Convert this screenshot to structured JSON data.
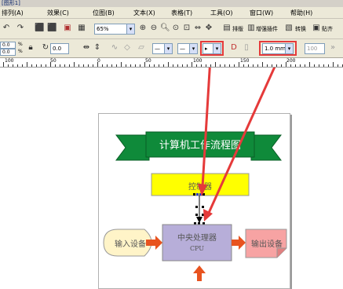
{
  "window": {
    "title": "[图形1]"
  },
  "menu": [
    {
      "label": "排列(A)",
      "key": "arrange"
    },
    {
      "label": "效果(C)",
      "key": "effects"
    },
    {
      "label": "位图(B)",
      "key": "bitmaps"
    },
    {
      "label": "文本(X)",
      "key": "text"
    },
    {
      "label": "表格(T)",
      "key": "table"
    },
    {
      "label": "工具(O)",
      "key": "tools"
    },
    {
      "label": "窗口(W)",
      "key": "window"
    },
    {
      "label": "帮助(H)",
      "key": "help"
    }
  ],
  "toolbar": {
    "zoom_value": "65%",
    "layout_label": "排版",
    "plugins_label": "增强插件",
    "convert_label": "转换",
    "paste_label": "贴齐"
  },
  "propertybar": {
    "x_value": "0.0",
    "y_value": "0.0",
    "x_unit": "%",
    "y_unit": "%",
    "rotation_value": "0.0",
    "outline_width_value": "1.0 mm",
    "opacity_value": "100"
  },
  "ruler": {
    "ticks": [
      "100",
      "50",
      "0",
      "50",
      "100",
      "150",
      "200"
    ]
  },
  "diagram": {
    "banner_text": "计算机工作流程图",
    "controller_text": "控制器",
    "input_text": "输入设备",
    "cpu_text_line1": "中央处理器",
    "cpu_text_line2": "CPU",
    "output_text": "输出设备"
  },
  "colors": {
    "banner_green": "#0f8a3a",
    "controller_yellow": "#ffff00",
    "cpu_purple": "#b7aed9",
    "input_cream": "#fff4c8",
    "output_pink": "#f7a3a3",
    "arrow_orange": "#e8531f",
    "highlight_red": "#e53a3a"
  }
}
